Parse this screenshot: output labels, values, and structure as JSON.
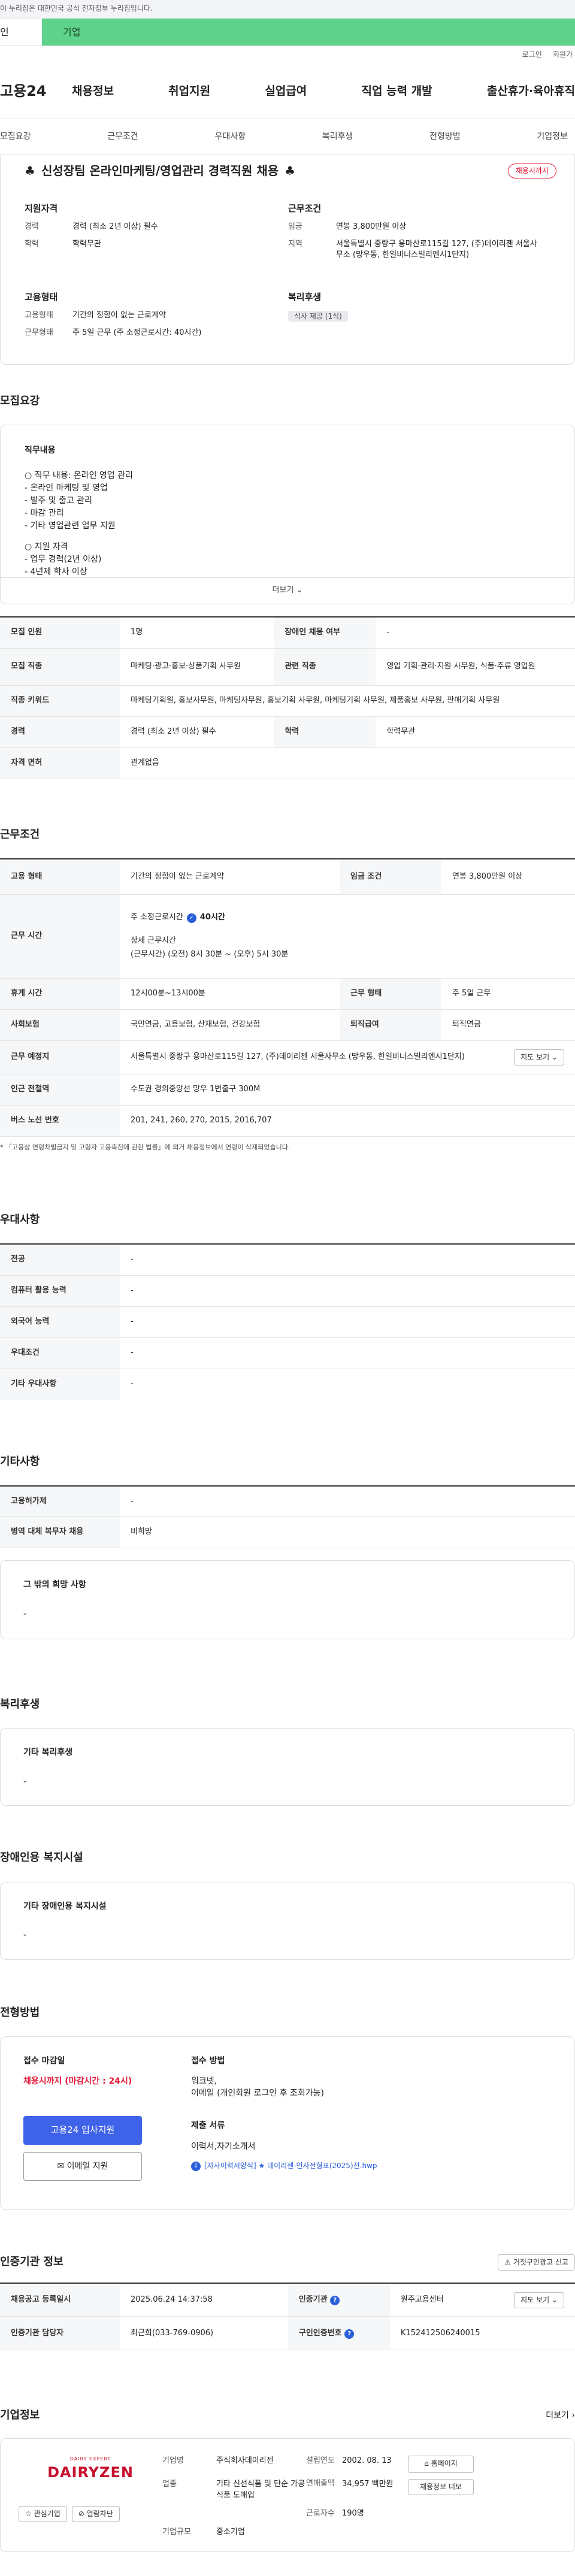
{
  "gov": "이 누리집은 대한민국 공식 전자정부 누리집입니다.",
  "tabs": {
    "personal": "인",
    "company": "기업"
  },
  "util": {
    "login": "로그인",
    "join": "회원가"
  },
  "gnb": {
    "logo": "고용24",
    "menu": [
      "채용정보",
      "취업지원",
      "실업급여",
      "직업 능력 개발",
      "출산휴가·육아휴직"
    ]
  },
  "subnav": [
    "모집요강",
    "근무조건",
    "우대사항",
    "복리후생",
    "전형방법",
    "기업정보"
  ],
  "job": {
    "title": "신성장팀 온라인마케팅/영업관리 경력직원 채용",
    "badge": "채용시까지",
    "club_icon": "♣",
    "qual_h": "지원자격",
    "exp_k": "경력",
    "exp_v": "경력 (최소 2년 이상) 필수",
    "edu_k": "학력",
    "edu_v": "학력무관",
    "cond_h": "근무조건",
    "pay_k": "임금",
    "pay_v": "연봉 3,800만원 이상",
    "loc_k": "지역",
    "loc_v": "서울특별시 중랑구 용마산로115길 127, (주)데이리젠 서울사무소 (망우동, 한일비너스빌리엔시1단지)",
    "type_h": "고용형태",
    "emp_k": "고용형태",
    "emp_v": "기간의 정함이 없는 근로계약",
    "wt_k": "근무형태",
    "wt_v": "주 5일 근무 (주 소정근로시간: 40시간)",
    "ben_h": "복리후생",
    "ben_chip": "식사 제공 (1식)"
  },
  "rec": {
    "sec": "모집요강",
    "h": "직무내용",
    "lines": [
      "○ 직무 내용: 온라인 영업 관리",
      "- 온라인 마케팅 및 영업",
      "- 발주 및 출고 관리",
      "- 마감 관리",
      "- 기타 영업관련 업무 지원",
      "",
      "○ 지원 자격",
      "- 업무 경력(2년 이상)",
      "- 4년제 학사 이상"
    ],
    "more": "더보기 ⌄"
  },
  "rec_table": {
    "r1": [
      "모집 인원",
      "1명",
      "장애인 채용 여부",
      "-"
    ],
    "r2": [
      "모집 직종",
      "마케팅·광고·홍보·상품기획 사무원",
      "관련 직종",
      "영업 기획·관리·지원 사무원, 식품·주류 영업원"
    ],
    "r3": [
      "직종 키워드",
      "마케팅기획원, 홍보사무원, 마케팅사무원, 홍보기획 사무원, 마케팅기획 사무원, 제품홍보 사무원, 판매기획 사무원"
    ],
    "r4": [
      "경력",
      "경력 (최소 2년 이상) 필수",
      "학력",
      "학력무관"
    ],
    "r5": [
      "자격 면허",
      "관계없음"
    ]
  },
  "work": {
    "sec": "근무조건",
    "r1": [
      "고용 형태",
      "기간의 정함이 없는 근로계약",
      "임금 조건",
      "연봉 3,800만원 이상"
    ],
    "r2_k": "근무 시간",
    "r2_a": "주 소정근로시간",
    "r2_b": "40시간",
    "r2_c": "상세 근무시간",
    "r2_d": "(근무시간) (오전) 8시 30분 ~ (오후) 5시 30분",
    "r3": [
      "휴게 시간",
      "12시00분~13시00분",
      "근무 형태",
      "주 5일 근무"
    ],
    "r4": [
      "사회보험",
      "국민연금, 고용보험, 산재보험, 건강보험",
      "퇴직급여",
      "퇴직연금"
    ],
    "r5": [
      "근무 예정지",
      "서울특별시 중랑구 용마산로115길 127, (주)데이리젠 서울사무소 (망우동, 한일비너스빌리엔시1단지)"
    ],
    "map": "지도 보기 ⌄",
    "r6": [
      "인근 전철역",
      "수도권 경의중앙선 망우 1번출구 300M"
    ],
    "r7": [
      "버스 노선 번호",
      "201, 241, 260, 270, 2015, 2016,707"
    ],
    "notice": "* 「고용상 연령차별금지 및 고령자 고용촉진에 관한 법률」에 의거 채용정보에서 연령이 삭제되었습니다."
  },
  "pref": {
    "sec": "우대사항",
    "rows": [
      [
        "전공",
        "-"
      ],
      [
        "컴퓨터 활용 능력",
        "-"
      ],
      [
        "외국어 능력",
        "-"
      ],
      [
        "우대조건",
        "-"
      ],
      [
        "기타 우대사항",
        "-"
      ]
    ]
  },
  "etc": {
    "sec": "기타사항",
    "rows": [
      [
        "고용허가제",
        "-"
      ],
      [
        "병역 대체 복무자 채용",
        "비희망"
      ]
    ],
    "hope_h": "그 밖의 희망 사항",
    "hope_v": "-"
  },
  "welf": {
    "sec": "복리후생",
    "h": "기타 복리후생",
    "v": "-"
  },
  "dis": {
    "sec": "장애인용 복지시설",
    "h": "기타 장애인용 복지시설",
    "v": "-"
  },
  "sel": {
    "sec": "전형방법",
    "close_h": "접수 마감일",
    "close_v": "채용시까지 (마감시간 : 24시)",
    "apply": "고용24 입사지원",
    "email": "✉ 이메일 지원",
    "method_h": "접수 방법",
    "method_v": [
      "워크넷,",
      "이메일 (개인회원 로그인 후 조회가능)"
    ],
    "docs_h": "제출 서류",
    "docs_v": "이력서,자기소개서",
    "file": "[자사이력서양식] ★ 데이리젠-인사전형표(2025)선.hwp"
  },
  "cert": {
    "sec": "인증기관 정보",
    "report": "⚠ 거짓구인광고 신고",
    "r1": [
      "채용공고 등록일시",
      "2025.06.24 14:37:58",
      "인증기관",
      "원주고용센터"
    ],
    "map": "지도 보기 ⌄",
    "r2": [
      "인증기관 담당자",
      "최근희(033-769-0906)",
      "구인인증번호",
      "K152412506240015"
    ]
  },
  "comp": {
    "sec": "기업정보",
    "more": "더보기 ›",
    "logo_top": "DAIRY EXPERT",
    "logo": "DAIRYZEN",
    "fav": "☆ 관심기업",
    "block": "⊘ 열람차단",
    "k1": "기업명",
    "v1": "주식회사데이리젠",
    "k2": "설립연도",
    "v2": "2002. 08. 13",
    "k3": "업종",
    "v3": "기타 신선식품 및 단순 가공식품 도매업",
    "k4": "연매출액",
    "v4": "34,957 백만원",
    "k5": "근로자수",
    "v5": "190명",
    "k6": "기업규모",
    "v6": "중소기업",
    "home": "⌂ 홈페이지",
    "other": "채용정보 더보"
  }
}
